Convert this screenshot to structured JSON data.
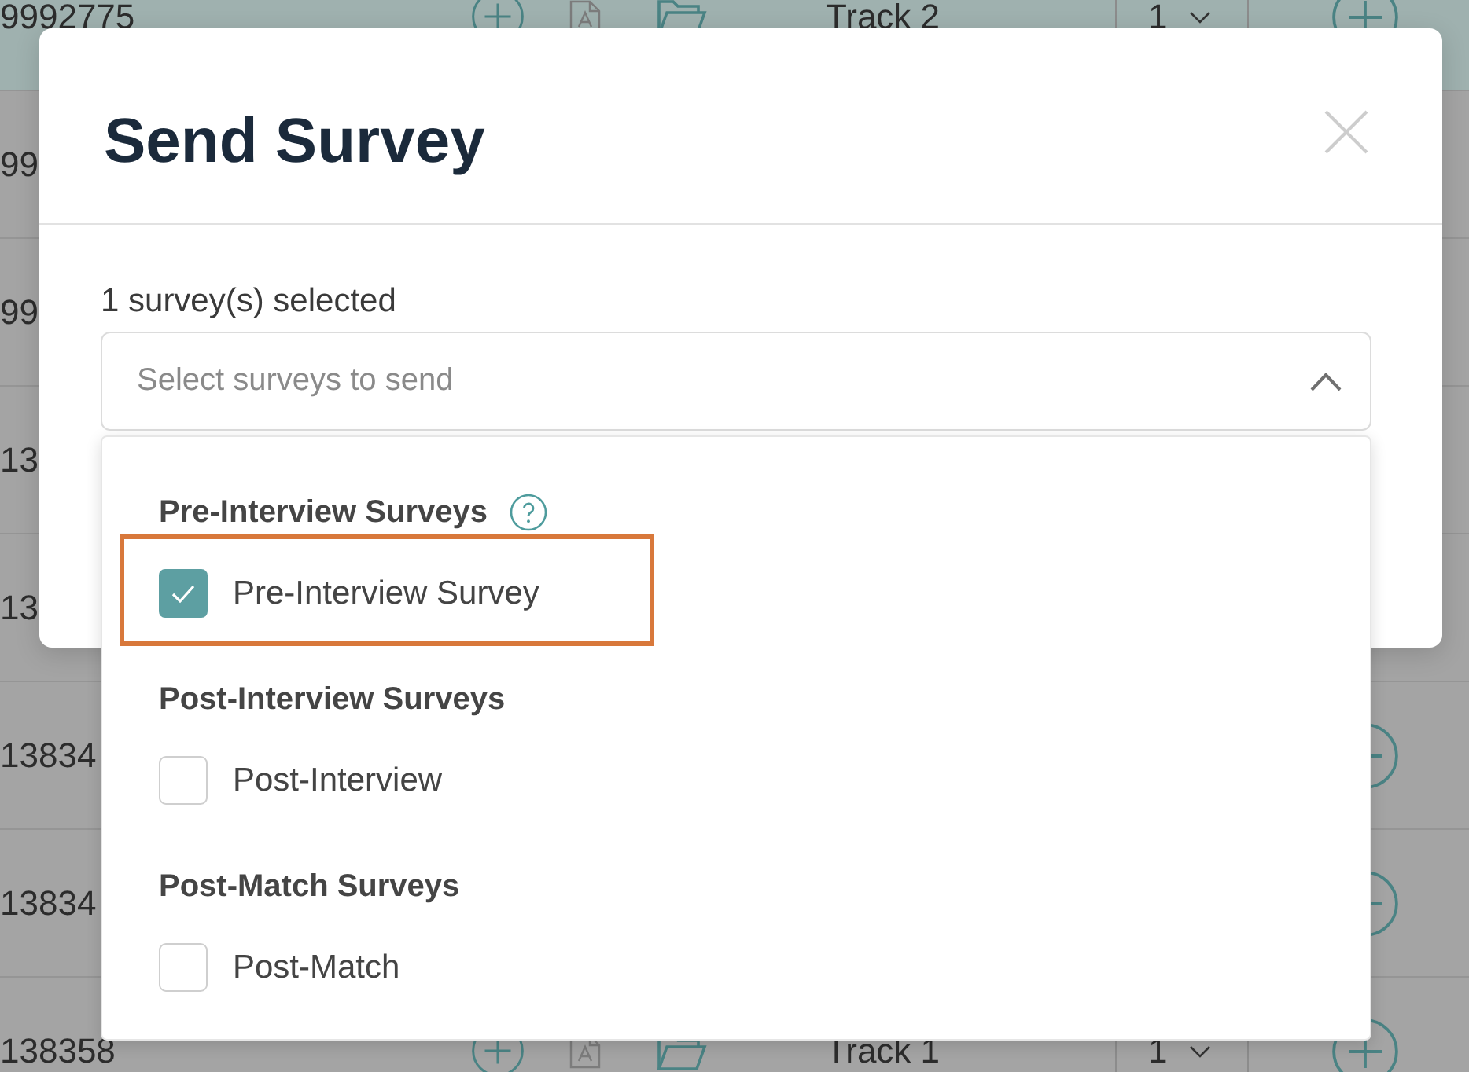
{
  "background_table": {
    "rows": [
      {
        "number": "9992775",
        "selected": true,
        "track": "Track 2",
        "quantity": "1",
        "action": {
          "kind": "add"
        }
      },
      {
        "number": "99",
        "selected": false
      },
      {
        "number": "99",
        "selected": false
      },
      {
        "number": "13",
        "selected": false
      },
      {
        "number": "13",
        "selected": false
      },
      {
        "number": "13834",
        "selected": false,
        "action": {
          "kind": "remove"
        }
      },
      {
        "number": "13834",
        "selected": false,
        "action": {
          "kind": "remove"
        }
      },
      {
        "number": "138358",
        "selected": false,
        "track": "Track 1",
        "quantity": "1",
        "action": {
          "kind": "add"
        }
      }
    ]
  },
  "modal": {
    "title": "Send Survey",
    "selected_count": "1 survey(s) selected",
    "select": {
      "placeholder": "Select surveys to send",
      "expanded": true
    },
    "groups": [
      {
        "heading": "Pre-Interview Surveys",
        "help": true,
        "options": [
          {
            "label": "Pre-Interview Survey",
            "checked": true,
            "highlighted": true
          }
        ]
      },
      {
        "heading": "Post-Interview Surveys",
        "help": false,
        "options": [
          {
            "label": "Post-Interview",
            "checked": false,
            "highlighted": false
          }
        ]
      },
      {
        "heading": "Post-Match Surveys",
        "help": false,
        "options": [
          {
            "label": "Post-Match",
            "checked": false,
            "highlighted": false
          }
        ]
      }
    ]
  }
}
